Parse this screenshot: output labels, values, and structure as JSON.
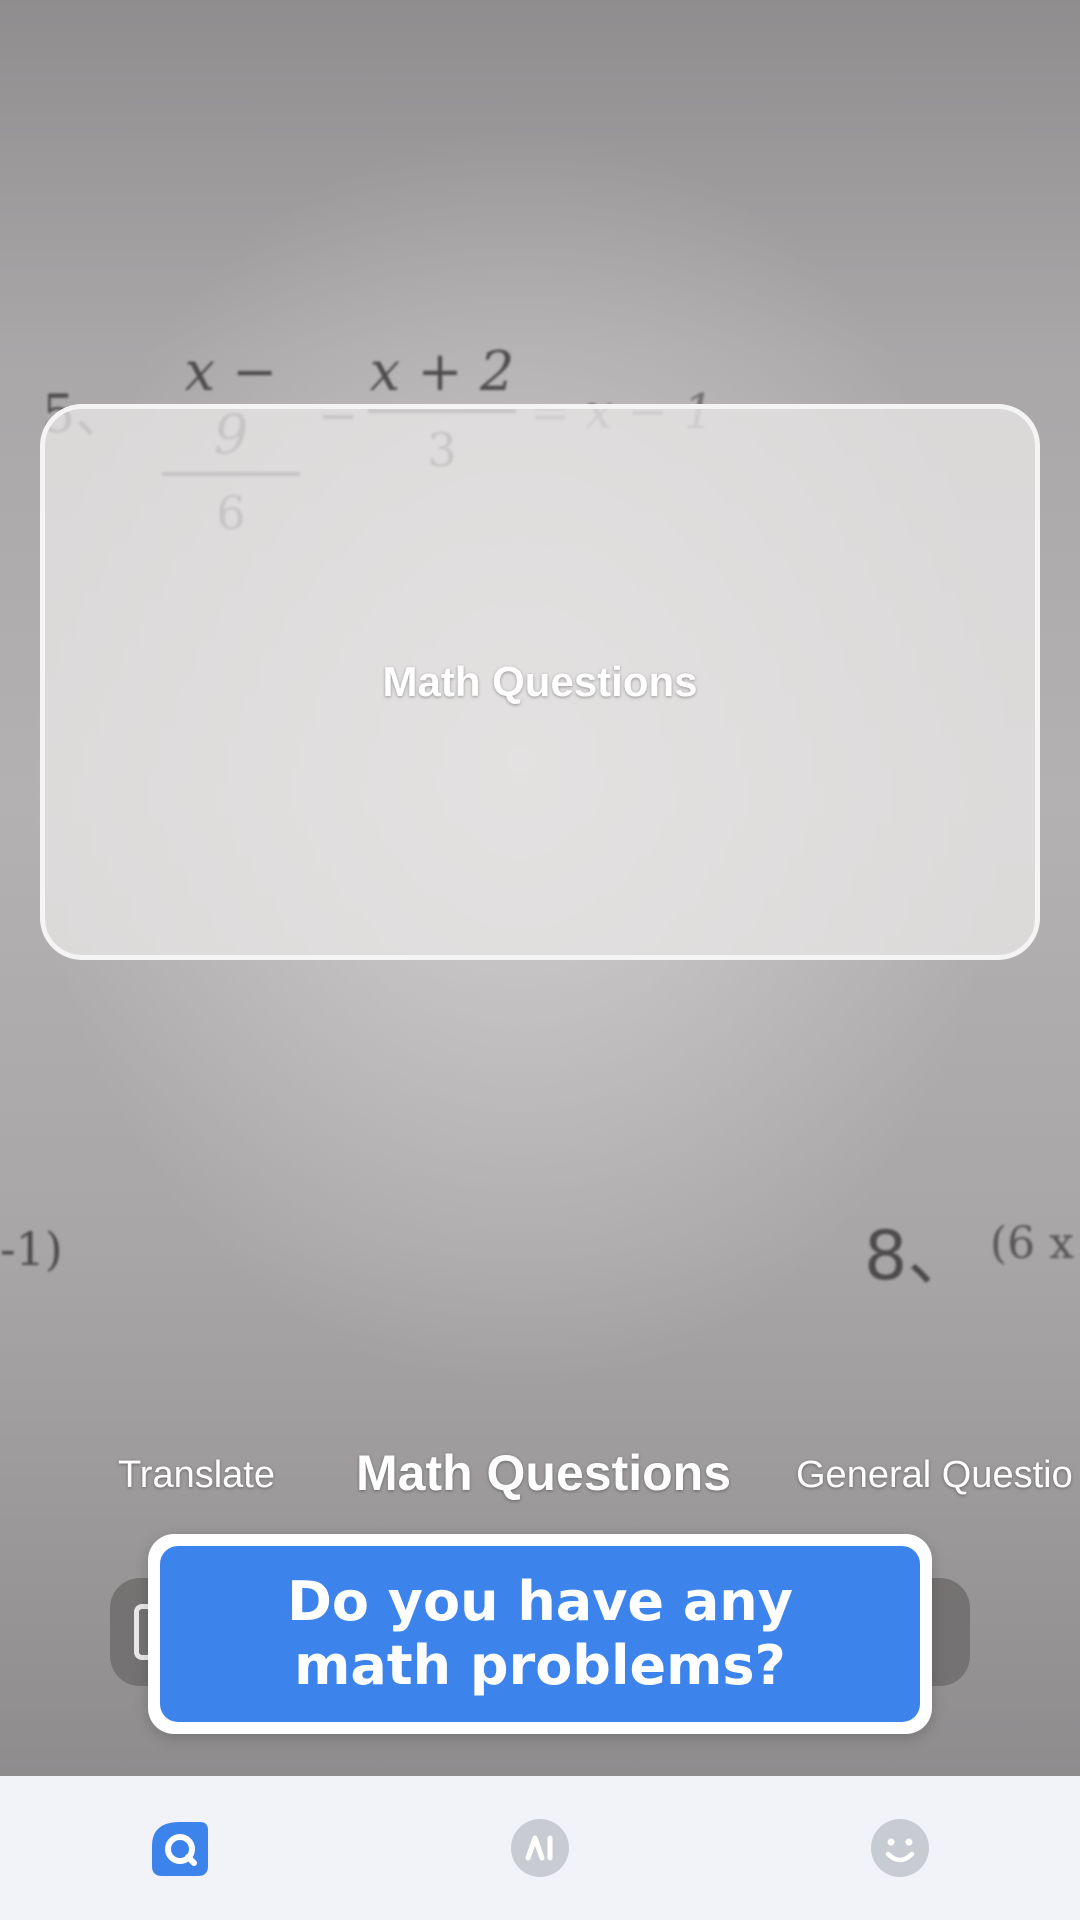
{
  "camera": {
    "equation": {
      "number": "5、",
      "frac1_num": "x − 9",
      "frac1_den": "6",
      "operator": "−",
      "frac2_num": "x + 2",
      "frac2_den": "3",
      "rhs": "= x − 1"
    },
    "left_fragment": "-1)",
    "right_fragment_number": "8、",
    "right_fragment_expr": "(6 x"
  },
  "scan_frame": {
    "label": "Math Questions"
  },
  "mode_tabs": {
    "items": [
      {
        "label": "Translate",
        "active": false
      },
      {
        "label": "Math Questions",
        "active": true
      },
      {
        "label": "General Questio",
        "active": false
      }
    ]
  },
  "banner": {
    "line1": "Do you have any",
    "line2": "math problems?"
  },
  "bottom_nav": {
    "items": [
      {
        "icon": "search-icon",
        "active": true,
        "color": "#3d83ec"
      },
      {
        "icon": "ai-icon",
        "active": false,
        "color": "#c9cbd3"
      },
      {
        "icon": "profile-icon",
        "active": false,
        "color": "#c9cbd3"
      }
    ]
  }
}
